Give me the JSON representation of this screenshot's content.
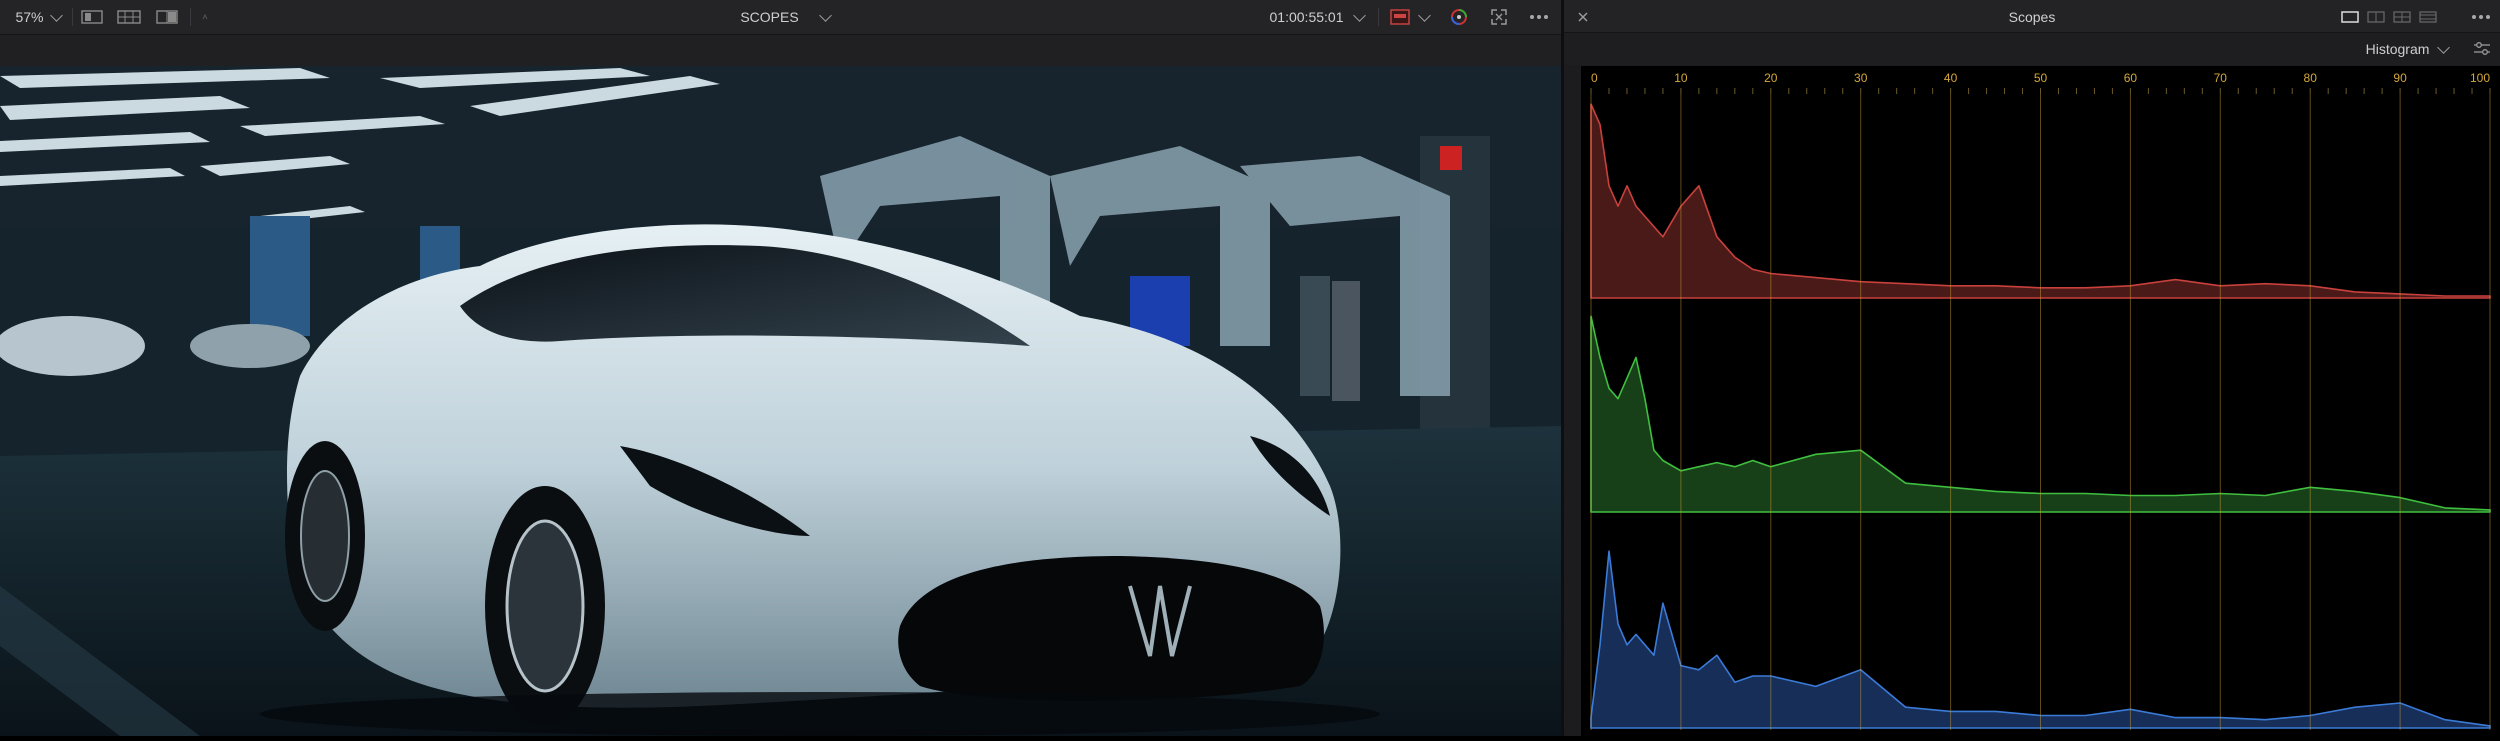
{
  "viewer": {
    "zoom": "57%",
    "title": "SCOPES",
    "timecode": "01:00:55:01"
  },
  "scopes": {
    "title": "Scopes",
    "mode": "Histogram",
    "scale_labels": [
      "0",
      "10",
      "20",
      "30",
      "40",
      "50",
      "60",
      "70",
      "80",
      "90",
      "100"
    ],
    "accent_color": "#d5a73a",
    "channels": [
      {
        "name": "red",
        "color": "#c8413c",
        "fill": "#4a1a18"
      },
      {
        "name": "green",
        "color": "#3fbf3f",
        "fill": "#184018"
      },
      {
        "name": "blue",
        "color": "#3b7bd8",
        "fill": "#162e58"
      }
    ]
  },
  "chart_data": {
    "type": "area",
    "x": [
      0,
      1,
      2,
      3,
      4,
      5,
      6,
      7,
      8,
      10,
      12,
      14,
      16,
      18,
      20,
      25,
      30,
      35,
      40,
      45,
      50,
      55,
      60,
      65,
      70,
      75,
      80,
      85,
      90,
      95,
      100
    ],
    "xlim": [
      0,
      100
    ],
    "series": [
      {
        "name": "red",
        "values": [
          0.95,
          0.85,
          0.55,
          0.45,
          0.55,
          0.45,
          0.4,
          0.35,
          0.3,
          0.45,
          0.55,
          0.3,
          0.2,
          0.14,
          0.12,
          0.1,
          0.08,
          0.07,
          0.06,
          0.06,
          0.05,
          0.05,
          0.06,
          0.09,
          0.06,
          0.07,
          0.06,
          0.03,
          0.02,
          0.01,
          0.01
        ]
      },
      {
        "name": "green",
        "values": [
          0.95,
          0.75,
          0.6,
          0.55,
          0.65,
          0.75,
          0.55,
          0.3,
          0.25,
          0.2,
          0.22,
          0.24,
          0.22,
          0.25,
          0.22,
          0.28,
          0.3,
          0.14,
          0.12,
          0.1,
          0.09,
          0.09,
          0.08,
          0.08,
          0.09,
          0.08,
          0.12,
          0.1,
          0.07,
          0.02,
          0.01
        ]
      },
      {
        "name": "blue",
        "values": [
          0.05,
          0.4,
          0.85,
          0.5,
          0.4,
          0.45,
          0.4,
          0.35,
          0.6,
          0.3,
          0.28,
          0.35,
          0.22,
          0.25,
          0.25,
          0.2,
          0.28,
          0.1,
          0.08,
          0.08,
          0.06,
          0.06,
          0.09,
          0.05,
          0.05,
          0.04,
          0.06,
          0.1,
          0.12,
          0.04,
          0.01
        ]
      }
    ]
  }
}
